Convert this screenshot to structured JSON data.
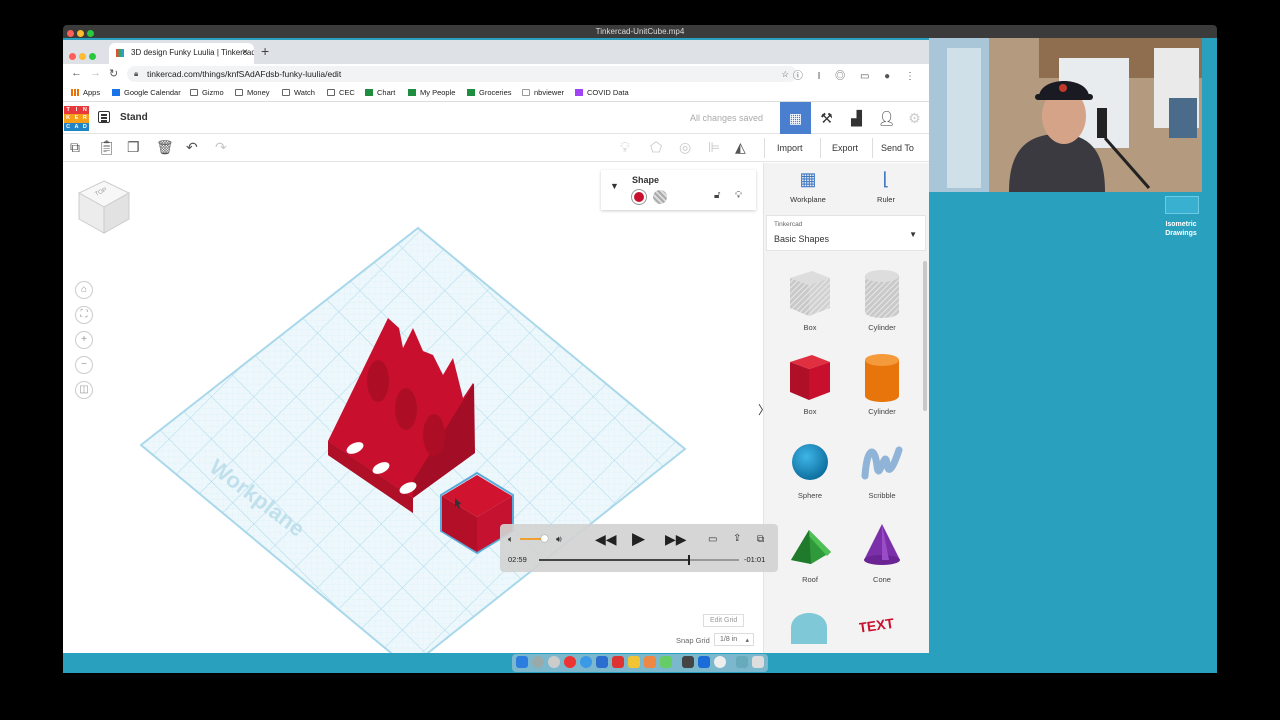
{
  "player": {
    "title": "Tinkercad-UnitCube.mp4"
  },
  "browser": {
    "tab_title": "3D design Funky Luulia | Tinkercad",
    "tab_close": "×",
    "new_tab": "+",
    "url": "tinkercad.com/things/knfSAdAFdsb-funky-luulia/edit",
    "bookmarks": [
      "Apps",
      "Google Calendar",
      "Gizmo",
      "Money",
      "Watch",
      "CEC",
      "Chart",
      "My People",
      "Groceries",
      "nbviewer",
      "COVID Data"
    ]
  },
  "tinkercad": {
    "logo_letters": [
      "TIN",
      "KER",
      "CAD"
    ],
    "design_name": "Stand",
    "save_status": "All changes saved",
    "toolbar": {
      "import": "Import",
      "export": "Export",
      "send_to": "Send To"
    },
    "view_cube_label": "TOP",
    "workplane_label": "Workplane",
    "shape_panel": {
      "title": "Shape",
      "solid_color": "#c8102e"
    },
    "edit_grid": "Edit Grid",
    "snap_grid_label": "Snap Grid",
    "snap_grid_value": "1/8 in",
    "right_panel": {
      "tools": [
        "Workplane",
        "Ruler"
      ],
      "library_small": "Tinkercad",
      "library_name": "Basic Shapes",
      "shapes": [
        {
          "label": "Box",
          "icon": "box-gray-icon"
        },
        {
          "label": "Cylinder",
          "icon": "cylinder-gray-icon"
        },
        {
          "label": "Box",
          "icon": "box-red-icon"
        },
        {
          "label": "Cylinder",
          "icon": "cylinder-orange-icon"
        },
        {
          "label": "Sphere",
          "icon": "sphere-blue-icon"
        },
        {
          "label": "Scribble",
          "icon": "scribble-icon"
        },
        {
          "label": "Roof",
          "icon": "roof-green-icon"
        },
        {
          "label": "Cone",
          "icon": "cone-purple-icon"
        },
        {
          "label": "",
          "icon": "round-roof-icon"
        },
        {
          "label": "",
          "icon": "text-icon"
        }
      ]
    }
  },
  "video": {
    "current_time": "02:59",
    "remaining_time": "-01:01",
    "progress": 0.746,
    "volume": 0.85
  },
  "desktop": {
    "icon_label": "Isometric Drawings"
  },
  "colors": {
    "accent": "#4a7fd0",
    "model_red": "#c8102e",
    "grid_blue": "#bde3f0",
    "desktop": "#2aa0bf"
  }
}
